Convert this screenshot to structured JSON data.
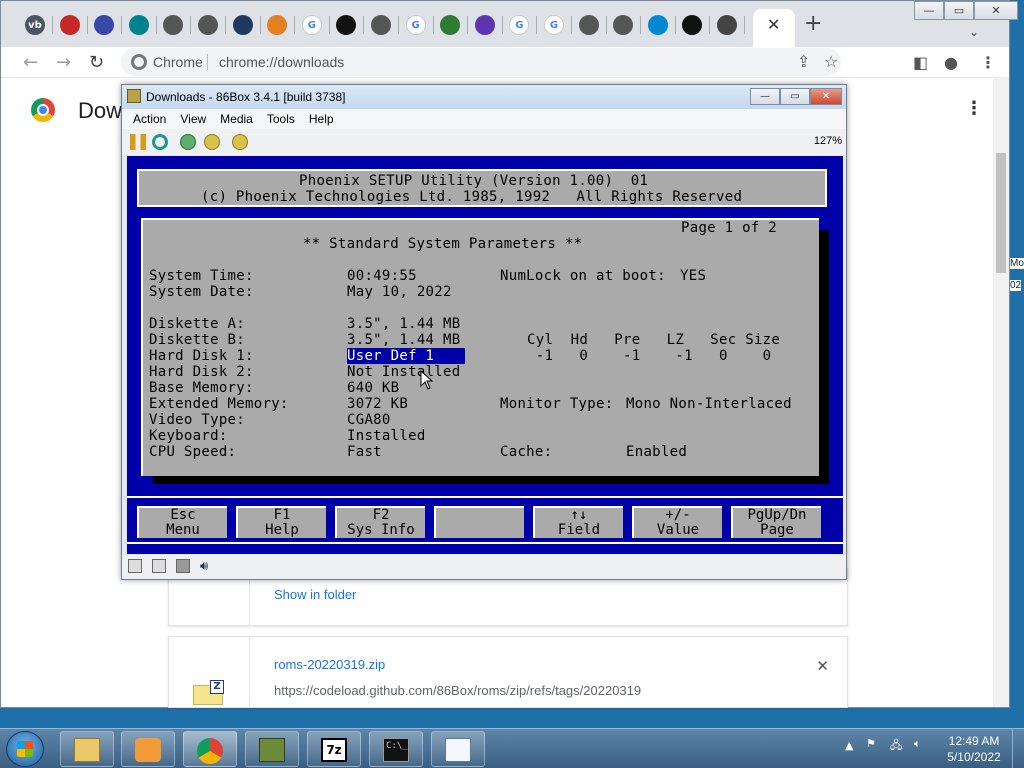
{
  "browser": {
    "tabs": [
      "vb",
      "",
      "",
      "",
      "",
      "",
      "",
      "",
      "G",
      "",
      "",
      "G",
      "",
      "",
      "G",
      "G",
      "",
      "",
      "",
      "",
      "",
      ""
    ],
    "active_tab_close": "✕",
    "new_tab": "+",
    "omnibox": {
      "site": "Chrome",
      "url": "chrome://downloads"
    },
    "page_title": "Dow",
    "downloads": [
      {
        "link": "Show in folder"
      },
      {
        "filename": "roms-20220319.zip",
        "url": "https://codeload.github.com/86Box/roms/zip/refs/tags/20220319",
        "close": "✕"
      }
    ],
    "side_fragments": [
      "Mo",
      "02"
    ]
  },
  "box86": {
    "title": "Downloads - 86Box 3.4.1 [build 3738]",
    "menu": [
      "Action",
      "View",
      "Media",
      "Tools",
      "Help"
    ],
    "zoom": "127%",
    "bios": {
      "header_line1": "Phoenix SETUP Utility (Version 1.00)  01",
      "header_line2": "(c) Phoenix Technologies Ltd. 1985, 1992   All Rights Reserved",
      "page": "Page 1 of 2",
      "section_title": "** Standard System Parameters **",
      "fields": {
        "system_time_label": "System Time:",
        "system_time": "00:49:55",
        "numlock_label": "NumLock on at boot:",
        "numlock": "YES",
        "system_date_label": "System Date:",
        "system_date": "May 10, 2022",
        "diskette_a_label": "Diskette A:",
        "diskette_a": "3.5\", 1.44 MB",
        "diskette_b_label": "Diskette B:",
        "diskette_b": "3.5\", 1.44 MB",
        "hd1_label": "Hard Disk 1:",
        "hd1": "User Def 1",
        "hd2_label": "Hard Disk 2:",
        "hd2": "Not Installed",
        "base_mem_label": "Base Memory:",
        "base_mem": "640 KB",
        "ext_mem_label": "Extended Memory:",
        "ext_mem": "3072 KB",
        "monitor_label": "Monitor Type:",
        "monitor": "Mono Non-Interlaced",
        "video_label": "Video Type:",
        "video": "CGA80",
        "keyboard_label": "Keyboard:",
        "keyboard": "Installed",
        "cpu_label": "CPU Speed:",
        "cpu": "Fast",
        "cache_label": "Cache:",
        "cache": "Enabled"
      },
      "geometry_header": "Cyl  Hd   Pre   LZ   Sec Size",
      "geometry_values": " -1   0    -1    -1   0    0",
      "fkeys": [
        {
          "key": "Esc",
          "action": "Menu"
        },
        {
          "key": "F1",
          "action": "Help"
        },
        {
          "key": "F2",
          "action": "Sys Info"
        },
        {
          "key": "",
          "action": ""
        },
        {
          "key": "↑↓",
          "action": "Field"
        },
        {
          "key": "+/-",
          "action": "Value"
        },
        {
          "key": "PgUp/Dn",
          "action": "Page"
        }
      ]
    }
  },
  "taskbar": {
    "time": "12:49 AM",
    "date": "5/10/2022",
    "tray_arrow": "▲"
  }
}
